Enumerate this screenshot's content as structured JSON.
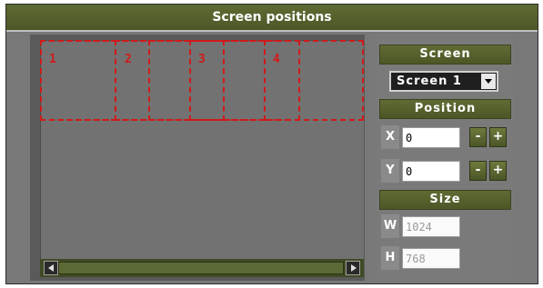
{
  "window": {
    "title": "Screen positions"
  },
  "screens": [
    {
      "label": "1"
    },
    {
      "label": "2"
    },
    {
      "label": "3"
    },
    {
      "label": "4"
    }
  ],
  "panel": {
    "screen_heading": "Screen",
    "screen_select_value": "Screen 1",
    "position_heading": "Position",
    "x_label": "X",
    "x_value": "0",
    "y_label": "Y",
    "y_value": "0",
    "minus_label": "-",
    "plus_label": "+",
    "size_heading": "Size",
    "w_label": "W",
    "w_value": "1024",
    "h_label": "H",
    "h_value": "768"
  },
  "colors": {
    "accent": "#56622c",
    "screen_outline": "#d11a1a",
    "background": "#787878"
  },
  "icons": {
    "scroll_left": "arrow-left-icon",
    "scroll_right": "arrow-right-icon",
    "dropdown": "chevron-down-icon"
  }
}
